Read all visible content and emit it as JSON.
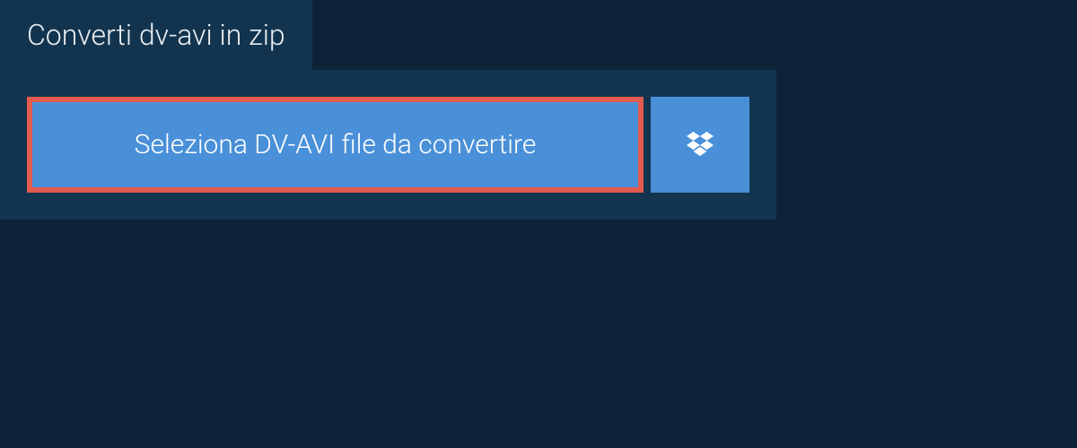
{
  "tab": {
    "title": "Converti dv-avi in zip"
  },
  "panel": {
    "select_button_label": "Seleziona DV-AVI file da convertire"
  }
}
